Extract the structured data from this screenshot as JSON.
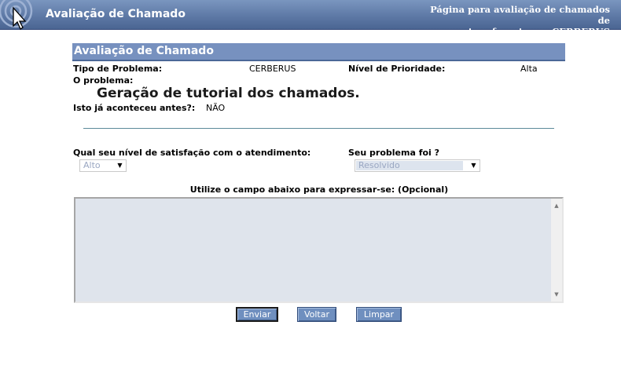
{
  "banner": {
    "title": "Avaliação de Chamado",
    "subtitle_line1": "Página para avaliação de chamados de",
    "subtitle_line2": "suporte referentes ao CERBERUS"
  },
  "section": {
    "header": "Avaliação de Chamado"
  },
  "ticket": {
    "type_label": "Tipo de Problema:",
    "type_value": "CERBERUS",
    "priority_label": "Nível de Prioridade:",
    "priority_value": "Alta",
    "problem_label": "O problema:",
    "problem_text": "Geração de tutorial dos chamados.",
    "happened_label": "Isto já aconteceu antes?:",
    "happened_value": "NÃO"
  },
  "form": {
    "satisfaction_label": "Qual seu nível de satisfação com o atendimento:",
    "satisfaction_selected": "Alto",
    "problem_status_label": "Seu problema foi ?",
    "problem_status_selected": "Resolvido",
    "comment_label": "Utilize o campo abaixo para expressar-se: (Opcional)",
    "comment_value": ""
  },
  "buttons": {
    "submit": "Enviar",
    "back": "Voltar",
    "clear": "Limpar"
  },
  "colors": {
    "banner": "#5e79a6",
    "section_header": "#7791bf",
    "button": "#6f8fbf",
    "textarea_bg": "#dfe4ec"
  }
}
